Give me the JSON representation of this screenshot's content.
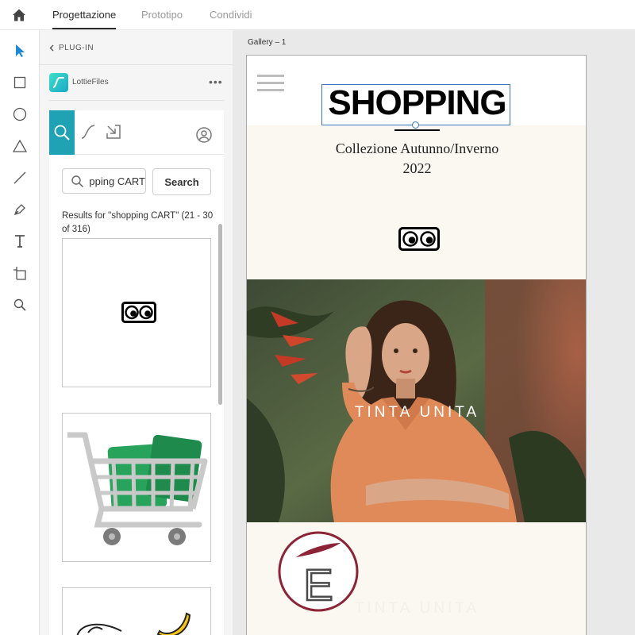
{
  "header": {
    "tabs": [
      {
        "label": "Progettazione",
        "active": true
      },
      {
        "label": "Prototipo",
        "active": false
      },
      {
        "label": "Condividi",
        "active": false
      }
    ]
  },
  "tools": [
    "select-icon",
    "rectangle-icon",
    "ellipse-icon",
    "triangle-icon",
    "line-icon",
    "pen-icon",
    "text-icon",
    "artboard-icon",
    "zoom-icon"
  ],
  "panel": {
    "back_label": "PLUG-IN",
    "plugin_name": "LottieFiles",
    "more_label": "•••",
    "search": {
      "value": "shopping CART",
      "button_label": "Search"
    },
    "results_text": "Results for \"shopping CART\" (21 - 30 of 316)"
  },
  "canvas": {
    "artboard_label": "Gallery – 1",
    "title": "SHOPPING",
    "subtitle_line1": "Collezione Autunno/Inverno",
    "subtitle_line2": "2022",
    "photo_caption": "TINTA UNITA",
    "footer_caption": "TINTA UNITA",
    "logo_letter": "E"
  },
  "colors": {
    "accent": "#1ea2b4",
    "selection": "#3b76c4",
    "beige": "#faf8f0",
    "logo_ring": "#8c2336"
  }
}
